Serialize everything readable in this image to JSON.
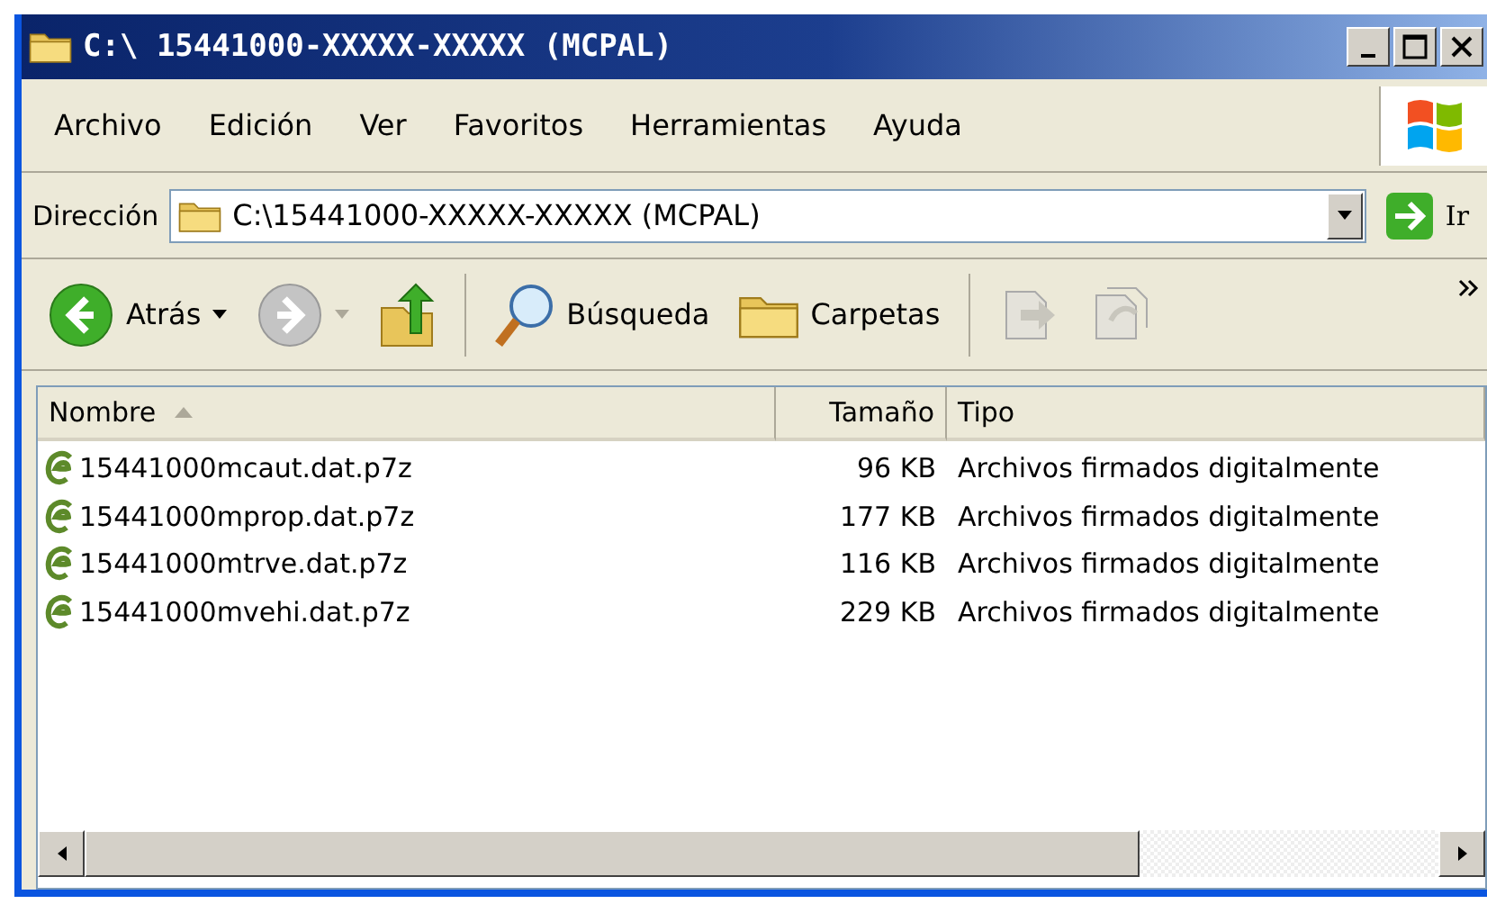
{
  "window": {
    "title": "C:\\ 15441000-XXXXX-XXXXX (MCPAL)"
  },
  "menu": [
    "Archivo",
    "Edición",
    "Ver",
    "Favoritos",
    "Herramientas",
    "Ayuda"
  ],
  "address": {
    "label": "Dirección",
    "value": "C:\\15441000-XXXXX-XXXXX (MCPAL)",
    "go": "Ir"
  },
  "toolbar": [
    {
      "kind": "back",
      "label": "Atrás",
      "disabled": false
    },
    {
      "kind": "forward",
      "disabled": true
    },
    {
      "kind": "up",
      "disabled": false
    },
    {
      "kind": "search",
      "label": "Búsqueda",
      "disabled": false
    },
    {
      "kind": "folders",
      "label": "Carpetas",
      "disabled": false
    },
    {
      "kind": "move",
      "disabled": true
    },
    {
      "kind": "copy",
      "disabled": true
    }
  ],
  "columns": [
    {
      "label": "Nombre",
      "sorted": true
    },
    {
      "label": "Tamaño",
      "sorted": false
    },
    {
      "label": "Tipo",
      "sorted": false
    }
  ],
  "rows": [
    {
      "name": "15441000mcaut.dat.p7z",
      "size": "96 KB",
      "type": "Archivos firmados digitalmente"
    },
    {
      "name": "15441000mprop.dat.p7z",
      "size": "177 KB",
      "type": "Archivos firmados digitalmente"
    },
    {
      "name": "15441000mtrve.dat.p7z",
      "size": "116 KB",
      "type": "Archivos firmados digitalmente"
    },
    {
      "name": "15441000mvehi.dat.p7z",
      "size": "229 KB",
      "type": "Archivos firmados digitalmente"
    }
  ]
}
